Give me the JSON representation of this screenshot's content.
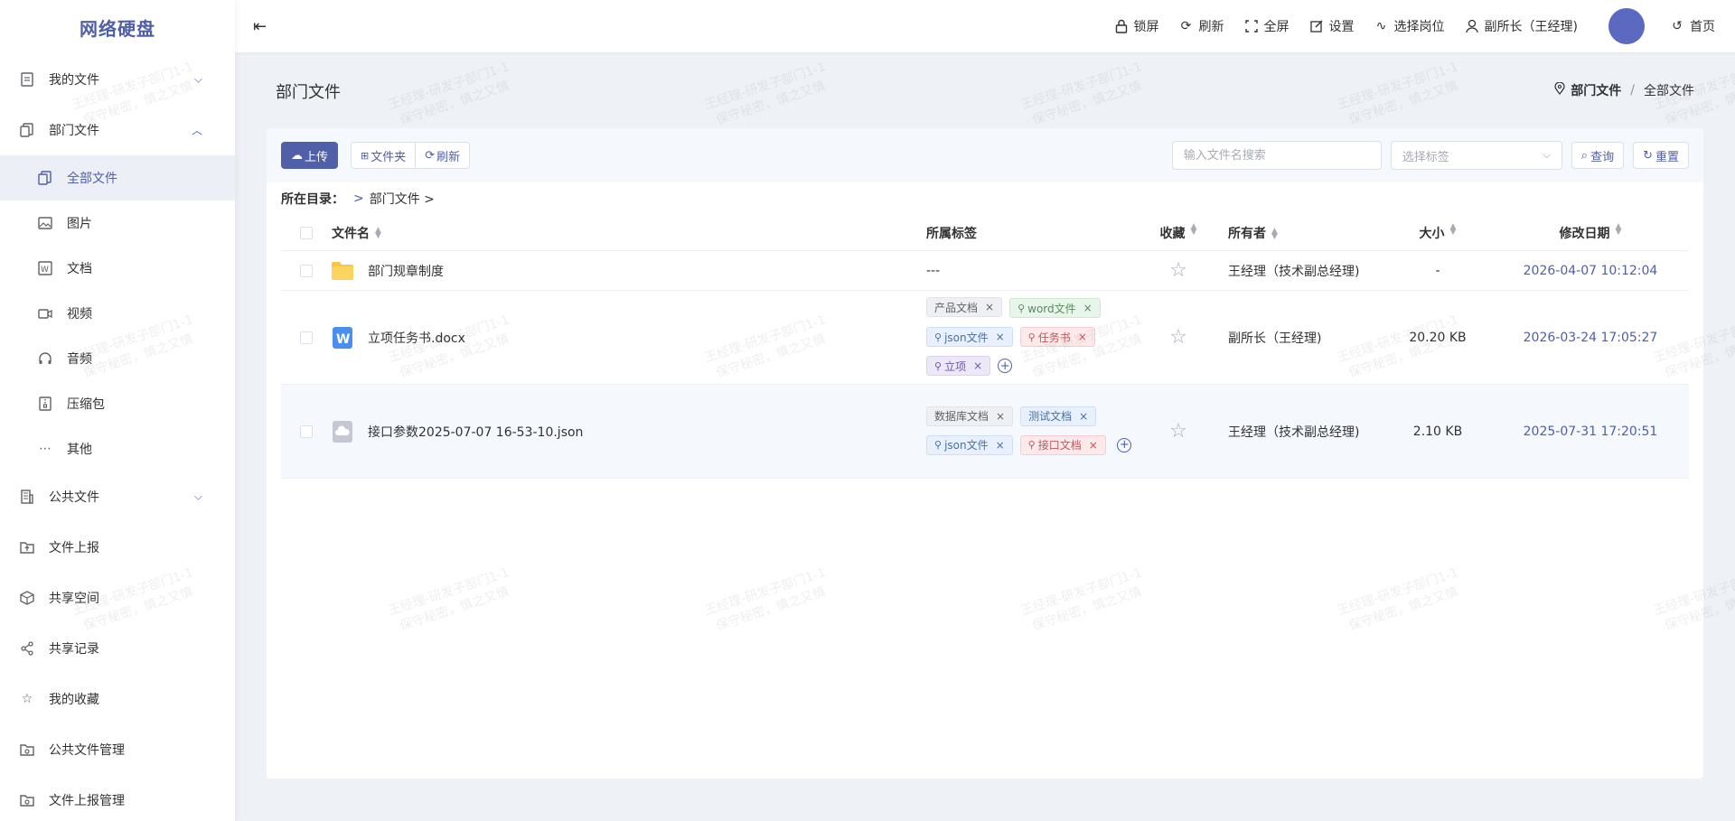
{
  "app": {
    "title": "网络硬盘"
  },
  "sidebar": {
    "items": [
      {
        "label": "我的文件",
        "arrow": "down"
      },
      {
        "label": "部门文件",
        "arrow": "up"
      },
      {
        "label": "公共文件",
        "arrow": "down"
      },
      {
        "label": "文件上报"
      },
      {
        "label": "共享空间"
      },
      {
        "label": "共享记录"
      },
      {
        "label": "我的收藏"
      },
      {
        "label": "公共文件管理"
      },
      {
        "label": "文件上报管理"
      }
    ],
    "subitems": [
      {
        "label": "全部文件",
        "active": true
      },
      {
        "label": "图片"
      },
      {
        "label": "文档"
      },
      {
        "label": "视频"
      },
      {
        "label": "音频"
      },
      {
        "label": "压缩包"
      },
      {
        "label": "其他"
      }
    ]
  },
  "header": {
    "lock": "锁屏",
    "refresh": "刷新",
    "fullscreen": "全屏",
    "settings": "设置",
    "select_post": "选择岗位",
    "user": "副所长（王经理)",
    "home": "首页"
  },
  "page": {
    "title": "部门文件",
    "breadcrumb": [
      "部门文件",
      "全部文件"
    ],
    "breadcrumb_sep": "/"
  },
  "toolbar": {
    "upload": "上传",
    "folder": "文件夹",
    "refresh": "刷新",
    "search_placeholder": "输入文件名搜索",
    "tag_placeholder": "选择标签",
    "query": "查询",
    "reset": "重置"
  },
  "directory": {
    "label": "所在目录：",
    "sep": ">",
    "path": "部门文件 >"
  },
  "table": {
    "headers": {
      "name": "文件名",
      "tags": "所属标签",
      "fav": "收藏",
      "owner": "所有者",
      "size": "大小",
      "date": "修改日期"
    },
    "rows": [
      {
        "type": "folder",
        "name": "部门规章制度",
        "tags_text": "---",
        "owner": "王经理（技术副总经理)",
        "size": "-",
        "date": "2026-04-07 10:12:04"
      },
      {
        "type": "word",
        "name": "立项任务书.docx",
        "tags": [
          {
            "label": "产品文档",
            "color": "gray",
            "person": false
          },
          {
            "label": "word文件",
            "color": "green",
            "person": true
          },
          {
            "label": "json文件",
            "color": "blue",
            "person": true
          },
          {
            "label": "任务书",
            "color": "red",
            "person": true
          },
          {
            "label": "立项",
            "color": "purple",
            "person": true
          }
        ],
        "owner": "副所长（王经理)",
        "size": "20.20 KB",
        "date": "2026-03-24 17:05:27"
      },
      {
        "type": "json",
        "name": "接口参数2025-07-07 16-53-10.json",
        "tags": [
          {
            "label": "数据库文档",
            "color": "gray",
            "person": false
          },
          {
            "label": "测试文档",
            "color": "blue",
            "person": false
          },
          {
            "label": "json文件",
            "color": "blue",
            "person": true
          },
          {
            "label": "接口文档",
            "color": "red",
            "person": true
          }
        ],
        "owner": "王经理（技术副总经理)",
        "size": "2.10 KB",
        "date": "2025-07-31 17:20:51"
      }
    ]
  },
  "watermark": {
    "line1": "王经理-研发子部门1-1",
    "line2": "保守秘密，慎之又慎"
  },
  "colors": {
    "accent": "#4f5fa8",
    "avatar": "#5b6ac0"
  }
}
